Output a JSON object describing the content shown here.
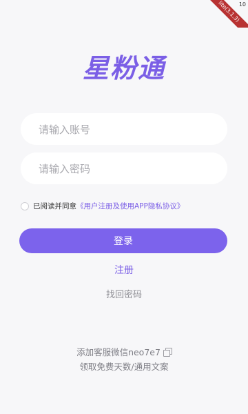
{
  "status": {
    "ribbon_text": "lite(3.1.3)",
    "battery_text": "10"
  },
  "app": {
    "logo_text": "星粉通"
  },
  "form": {
    "account_placeholder": "请输入账号",
    "password_placeholder": "请输入密码",
    "agree_prefix": "已阅读并同意",
    "agree_link": "《用户注册及使用APP隐私协议》",
    "login_label": "登录",
    "register_label": "注册",
    "forgot_label": "找回密码"
  },
  "footer": {
    "wechat_text": "添加客服微信neo7e7",
    "promo_text": "领取免费天数/通用文案"
  },
  "colors": {
    "accent": "#7c63ec",
    "background": "#f7f7f9"
  }
}
